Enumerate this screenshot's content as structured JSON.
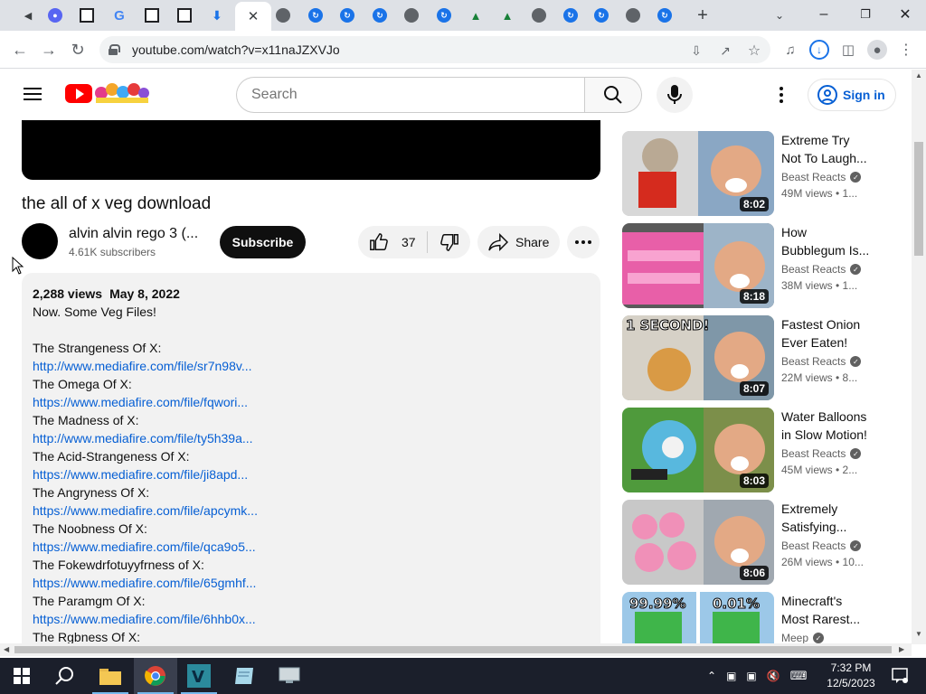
{
  "browser": {
    "url": "youtube.com/watch?v=x11naJZXVJo",
    "tabs": [
      {
        "icon": "audio-mute-icon"
      },
      {
        "icon": "discord-icon"
      },
      {
        "icon": "archive-icon"
      },
      {
        "icon": "google-icon"
      },
      {
        "icon": "archive-icon"
      },
      {
        "icon": "archive-icon"
      },
      {
        "icon": "download-icon"
      },
      {
        "icon": "close-icon",
        "active": true
      },
      {
        "icon": "globe-icon"
      },
      {
        "icon": "link-icon"
      },
      {
        "icon": "link-icon"
      },
      {
        "icon": "link-icon"
      },
      {
        "icon": "globe-icon"
      },
      {
        "icon": "link-icon"
      },
      {
        "icon": "drive-icon"
      },
      {
        "icon": "drive-icon"
      },
      {
        "icon": "globe-icon"
      },
      {
        "icon": "link-icon"
      },
      {
        "icon": "link-icon"
      },
      {
        "icon": "globe-icon"
      },
      {
        "icon": "link-icon"
      }
    ]
  },
  "youtube": {
    "search_placeholder": "Search",
    "sign_in_label": "Sign in",
    "video": {
      "title": "the all of x veg download",
      "channel": "alvin alvin rego 3 (...",
      "subscribers": "4.61K subscribers",
      "subscribe_label": "Subscribe",
      "likes": "37",
      "share_label": "Share",
      "views": "2,288 views",
      "date": "May 8, 2022",
      "description_intro": "Now. Some Veg Files!",
      "files": [
        {
          "name": "The Strangeness Of X:",
          "link": "http://www.mediafire.com/file/sr7n98v..."
        },
        {
          "name": "The Omega Of X:",
          "link": "https://www.mediafire.com/file/fqwori..."
        },
        {
          "name": "The Madness of X:",
          "link": "http://www.mediafire.com/file/ty5h39a..."
        },
        {
          "name": "The Acid-Strangeness Of X:",
          "link": "https://www.mediafire.com/file/ji8apd..."
        },
        {
          "name": "The Angryness Of X:",
          "link": "https://www.mediafire.com/file/apcymk..."
        },
        {
          "name": "The Noobness Of X:",
          "link": "https://www.mediafire.com/file/qca9o5..."
        },
        {
          "name": "The Fokewdrfotuyyfrness of X:",
          "link": "https://www.mediafire.com/file/65gmhf..."
        },
        {
          "name": "The Paramgm Of X:",
          "link": "https://www.mediafire.com/file/6hhb0x..."
        },
        {
          "name": "The Rgbness Of X:",
          "link": ""
        }
      ]
    },
    "recommendations": [
      {
        "title_l1": "Extreme Try",
        "title_l2": "Not To Laugh...",
        "channel": "Beast Reacts",
        "meta": "49M views • 1...",
        "duration": "8:02"
      },
      {
        "title_l1": "How",
        "title_l2": "Bubblegum Is...",
        "channel": "Beast Reacts",
        "meta": "38M views • 1...",
        "duration": "8:18"
      },
      {
        "title_l1": "Fastest Onion",
        "title_l2": "Ever Eaten!",
        "channel": "Beast Reacts",
        "meta": "22M views • 8...",
        "duration": "8:07",
        "thumb_text": "1 SECOND!"
      },
      {
        "title_l1": "Water Balloons",
        "title_l2": "in Slow Motion!",
        "channel": "Beast Reacts",
        "meta": "45M views • 2...",
        "duration": "8:03"
      },
      {
        "title_l1": "Extremely",
        "title_l2": "Satisfying...",
        "channel": "Beast Reacts",
        "meta": "26M views • 10...",
        "duration": "8:06"
      },
      {
        "title_l1": "Minecraft's",
        "title_l2": "Most Rarest...",
        "channel": "Meep",
        "meta": "",
        "duration": "",
        "thumb_left": "99.99%",
        "thumb_right": "0.01%"
      }
    ]
  },
  "taskbar": {
    "time": "7:32 PM",
    "date": "12/5/2023"
  },
  "colors": {
    "yt_red": "#ff0000",
    "link_blue": "#065fd4",
    "taskbar": "#1b1f2b"
  }
}
